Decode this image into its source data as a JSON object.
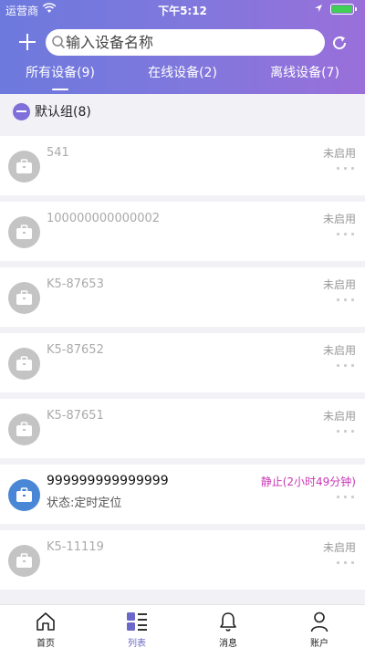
{
  "status_bar": {
    "carrier": "运营商",
    "time": "下午5:12"
  },
  "search": {
    "placeholder": "输入设备名称"
  },
  "tabs": [
    {
      "label": "所有设备(9)",
      "active": true
    },
    {
      "label": "在线设备(2)",
      "active": false
    },
    {
      "label": "离线设备(7)",
      "active": false
    }
  ],
  "group": {
    "label": "默认组(8)"
  },
  "devices": [
    {
      "name": "541",
      "status": "未启用",
      "sub": ""
    },
    {
      "name": "100000000000002",
      "status": "未启用",
      "sub": ""
    },
    {
      "name": "K5-87653",
      "status": "未启用",
      "sub": ""
    },
    {
      "name": "K5-87652",
      "status": "未启用",
      "sub": ""
    },
    {
      "name": "K5-87651",
      "status": "未启用",
      "sub": ""
    },
    {
      "name": "999999999999999",
      "status": "静止(2小时49分钟)",
      "sub": "状态:定时定位",
      "active": true
    },
    {
      "name": "K5-11119",
      "status": "未启用",
      "sub": ""
    }
  ],
  "tabbar": [
    {
      "label": "首页",
      "icon": "home-icon"
    },
    {
      "label": "列表",
      "icon": "list-icon",
      "active": true
    },
    {
      "label": "消息",
      "icon": "bell-icon"
    },
    {
      "label": "账户",
      "icon": "user-icon"
    }
  ],
  "colors": {
    "header_start": "#6d79dd",
    "header_end": "#9a6fda",
    "active_device_icon": "#4a86d6",
    "moving_status": "#c837b4",
    "tab_active": "#6a68c8"
  }
}
